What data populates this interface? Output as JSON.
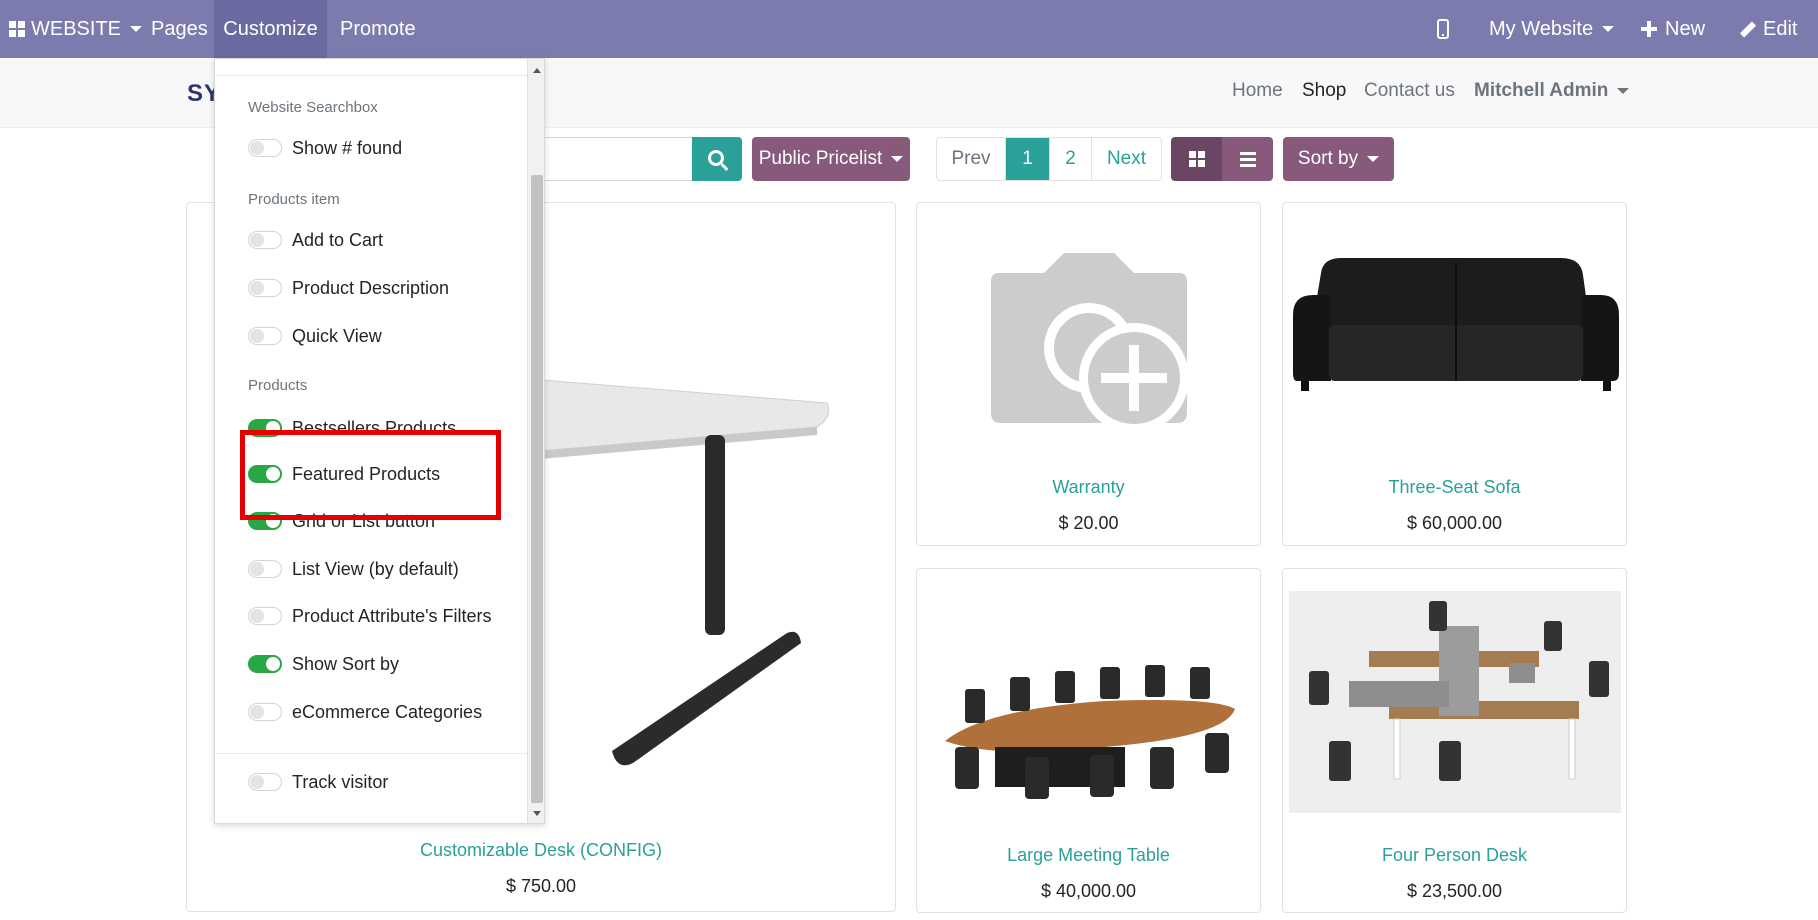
{
  "topbar": {
    "website": "WEBSITE",
    "pages": "Pages",
    "customize": "Customize",
    "promote": "Promote",
    "my_website": "My Website",
    "new": "New",
    "edit": "Edit"
  },
  "site_header": {
    "logo": "SY",
    "nav": {
      "home": "Home",
      "shop": "Shop",
      "contact": "Contact us"
    },
    "user": "Mitchell Admin"
  },
  "toolbar": {
    "pricelist": "Public Pricelist",
    "pager": {
      "prev": "Prev",
      "page1": "1",
      "page2": "2",
      "next": "Next"
    },
    "sort_by": "Sort by"
  },
  "products": [
    {
      "name": "Customizable Desk (CONFIG)",
      "price": "$ 750.00"
    },
    {
      "name": "Warranty",
      "price": "$ 20.00"
    },
    {
      "name": "Three-Seat Sofa",
      "price": "$ 60,000.00"
    },
    {
      "name": "Large Meeting Table",
      "price": "$ 40,000.00"
    },
    {
      "name": "Four Person Desk",
      "price": "$ 23,500.00"
    }
  ],
  "customize_menu": {
    "sections": [
      {
        "header": "Website Searchbox",
        "items": [
          {
            "label": "Show # found",
            "on": false
          }
        ]
      },
      {
        "header": "Products item",
        "items": [
          {
            "label": "Add to Cart",
            "on": false
          },
          {
            "label": "Product Description",
            "on": false
          },
          {
            "label": "Quick View",
            "on": false
          }
        ]
      },
      {
        "header": "Products",
        "items": [
          {
            "label": "Bestsellers Products",
            "on": true
          },
          {
            "label": "Featured Products",
            "on": true
          },
          {
            "label": "Grid or List button",
            "on": true
          },
          {
            "label": "List View (by default)",
            "on": false
          },
          {
            "label": "Product Attribute's Filters",
            "on": false
          },
          {
            "label": "Show Sort by",
            "on": true
          },
          {
            "label": "eCommerce Categories",
            "on": false
          }
        ]
      },
      {
        "header": "",
        "items": [
          {
            "label": "Track visitor",
            "on": false
          }
        ]
      }
    ]
  },
  "colors": {
    "topbar": "#7c7bad",
    "accent": "#2aa198",
    "button": "#875a7b",
    "toggle_on": "#28a745",
    "highlight": "#e60000"
  }
}
